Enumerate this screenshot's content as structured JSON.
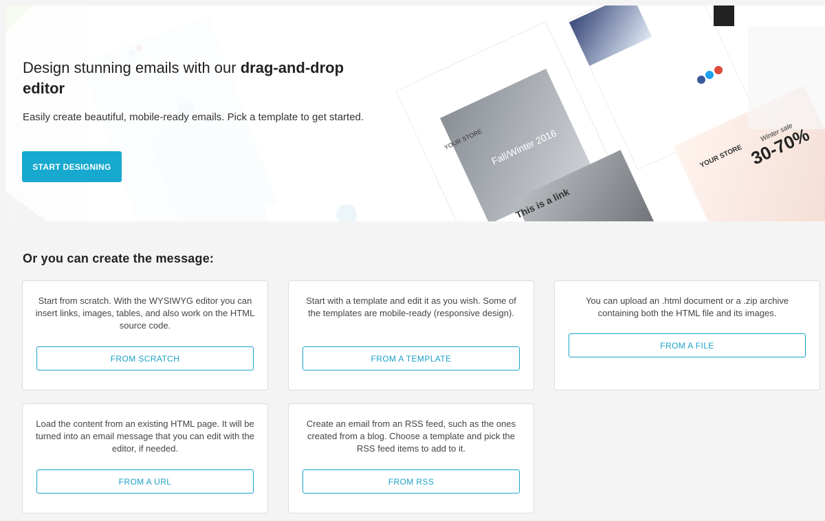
{
  "hero": {
    "title_plain": "Design stunning emails with our ",
    "title_bold": "drag-and-drop",
    "title_end": "editor",
    "subtitle": "Easily create beautiful, mobile-ready emails. Pick a template to get started.",
    "cta_label": "START DESIGNING",
    "accent_color": "#17a9cf",
    "template_images": {
      "store_label_1": "YOUR STORE",
      "store_label_2": "YOUR STORE",
      "season_text": "Fall/Winter 2016",
      "link_text": "This is a link",
      "sale_label": "Winter sale",
      "sale_percent": "30-70%"
    }
  },
  "section": {
    "title": "Or you can create the message:"
  },
  "options": [
    {
      "description": "Start from scratch. With the WYSIWYG editor you can insert links, images, tables, and also work on the HTML source code.",
      "button": "FROM SCRATCH"
    },
    {
      "description": "Start with a template and edit it as you wish. Some of the templates are mobile-ready (responsive design).",
      "button": "FROM A TEMPLATE"
    },
    {
      "description": "You can upload an .html document or a .zip archive containing both the HTML file and its images.",
      "button": "FROM A FILE"
    },
    {
      "description": "Load the content from an existing HTML page. It will be turned into an email message that you can edit with the editor, if needed.",
      "button": "FROM A URL"
    },
    {
      "description": "Create an email from an RSS feed, such as the ones created from a blog. Choose a template and pick the RSS feed items to add to it.",
      "button": "FROM RSS"
    }
  ]
}
